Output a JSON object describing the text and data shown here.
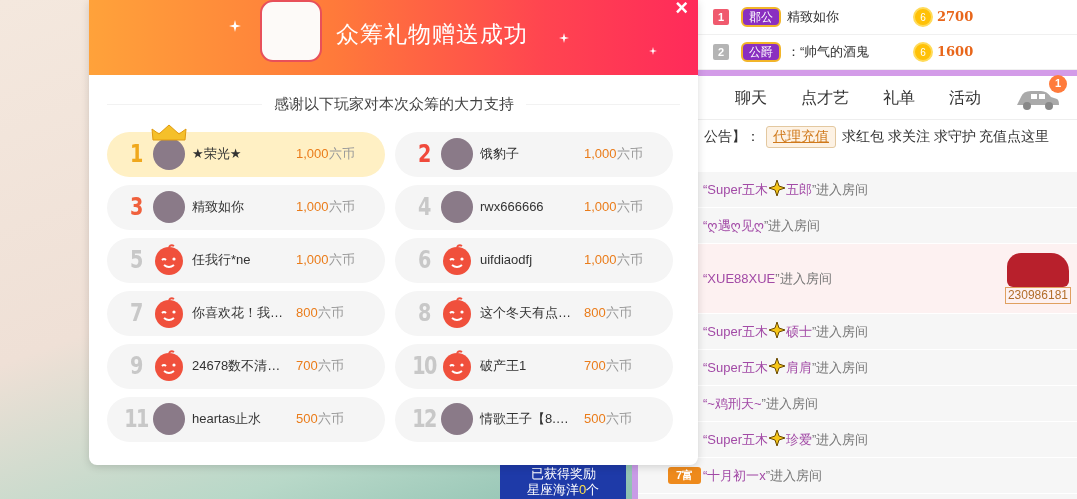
{
  "video": {
    "reward_banner": {
      "line_1": "已获得奖励",
      "line_2_prefix": "星座海洋",
      "line_2_count": "0",
      "line_2_suffix": "个"
    }
  },
  "modal": {
    "title": "众筹礼物赠送成功",
    "close": "×",
    "subtitle": "感谢以下玩家对本次众筹的大力支持",
    "supporters": [
      {
        "rank": "1",
        "color": "#f0a81c",
        "kind": "photo",
        "crowned": true,
        "highlighted": true,
        "name": "★荣光★",
        "amount": "1,000",
        "unit": "六币"
      },
      {
        "rank": "2",
        "color": "#f04a3c",
        "kind": "photo",
        "crowned": false,
        "highlighted": false,
        "name": "饿豹子",
        "amount": "1,000",
        "unit": "六币"
      },
      {
        "rank": "3",
        "color": "#f0603c",
        "kind": "photo",
        "crowned": false,
        "highlighted": false,
        "name": "精致如你",
        "amount": "1,000",
        "unit": "六币"
      },
      {
        "rank": "4",
        "color": "#c8c8c8",
        "kind": "photo",
        "crowned": false,
        "highlighted": false,
        "name": "rwx666666",
        "amount": "1,000",
        "unit": "六币"
      },
      {
        "rank": "5",
        "color": "#c8c8c8",
        "kind": "default",
        "crowned": false,
        "highlighted": false,
        "name": "任我行*ne",
        "amount": "1,000",
        "unit": "六币"
      },
      {
        "rank": "6",
        "color": "#c8c8c8",
        "kind": "default",
        "crowned": false,
        "highlighted": false,
        "name": "uifdiaodfj",
        "amount": "1,000",
        "unit": "六币"
      },
      {
        "rank": "7",
        "color": "#c8c8c8",
        "kind": "default",
        "crowned": false,
        "highlighted": false,
        "name": "你喜欢花！我…",
        "amount": "800",
        "unit": "六币"
      },
      {
        "rank": "8",
        "color": "#c8c8c8",
        "kind": "default",
        "crowned": false,
        "highlighted": false,
        "name": "这个冬天有点…",
        "amount": "800",
        "unit": "六币"
      },
      {
        "rank": "9",
        "color": "#c8c8c8",
        "kind": "default",
        "crowned": false,
        "highlighted": false,
        "name": "24678数不清…",
        "amount": "700",
        "unit": "六币"
      },
      {
        "rank": "10",
        "color": "#c8c8c8",
        "kind": "default",
        "crowned": false,
        "highlighted": false,
        "name": "破产王1",
        "amount": "700",
        "unit": "六币"
      },
      {
        "rank": "11",
        "color": "#c8c8c8",
        "kind": "photo",
        "crowned": false,
        "highlighted": false,
        "name": "heartas止水",
        "amount": "500",
        "unit": "六币"
      },
      {
        "rank": "12",
        "color": "#c8c8c8",
        "kind": "photo",
        "crowned": false,
        "highlighted": false,
        "name": "情歌王子【8.…",
        "amount": "500",
        "unit": "六币"
      }
    ]
  },
  "panel": {
    "ranking": [
      {
        "rank": "1",
        "color": "#f05a6e",
        "title": "郡公",
        "name": "精致如你",
        "coin": "6",
        "amount": "2700"
      },
      {
        "rank": "2",
        "color": "#b4b4b4",
        "title": "公爵",
        "name": "：“帅气的酒鬼",
        "coin": "6",
        "amount": "1600"
      }
    ],
    "tabs": [
      "聊天",
      "点才艺",
      "礼单",
      "活动"
    ],
    "car_badge": "1",
    "announcement": {
      "prefix": "公告】：",
      "tag": "代理充值",
      "text": "求红包 求关注 求守护 充值点这里"
    },
    "chat": [
      {
        "kind": "enter",
        "open": "“",
        "names": [
          "Super五木",
          "五郎"
        ],
        "close": "”进入房间"
      },
      {
        "kind": "enter",
        "open": "“",
        "names": [
          "ღ遇ღ见ღ"
        ],
        "close": "”进入房间"
      },
      {
        "kind": "car",
        "open": "“",
        "names": [
          "XUE88XUE"
        ],
        "close": "”进入房间",
        "car_id": "230986181"
      },
      {
        "kind": "enter",
        "open": "“",
        "names": [
          "Super五木",
          "硕士"
        ],
        "close": "”进入房间"
      },
      {
        "kind": "enter",
        "open": "“",
        "names": [
          "Super五木",
          "肩肩"
        ],
        "close": "”进入房间"
      },
      {
        "kind": "enter",
        "open": "“",
        "names": [
          "~鸡刑天~"
        ],
        "close": "”进入房间"
      },
      {
        "kind": "enter",
        "open": "“",
        "names": [
          "Super五木",
          "珍爱"
        ],
        "close": "”进入房间"
      },
      {
        "kind": "badge",
        "badge": "7富",
        "open": "“",
        "names": [
          "十月初一x"
        ],
        "close": "”进入房间"
      }
    ]
  }
}
